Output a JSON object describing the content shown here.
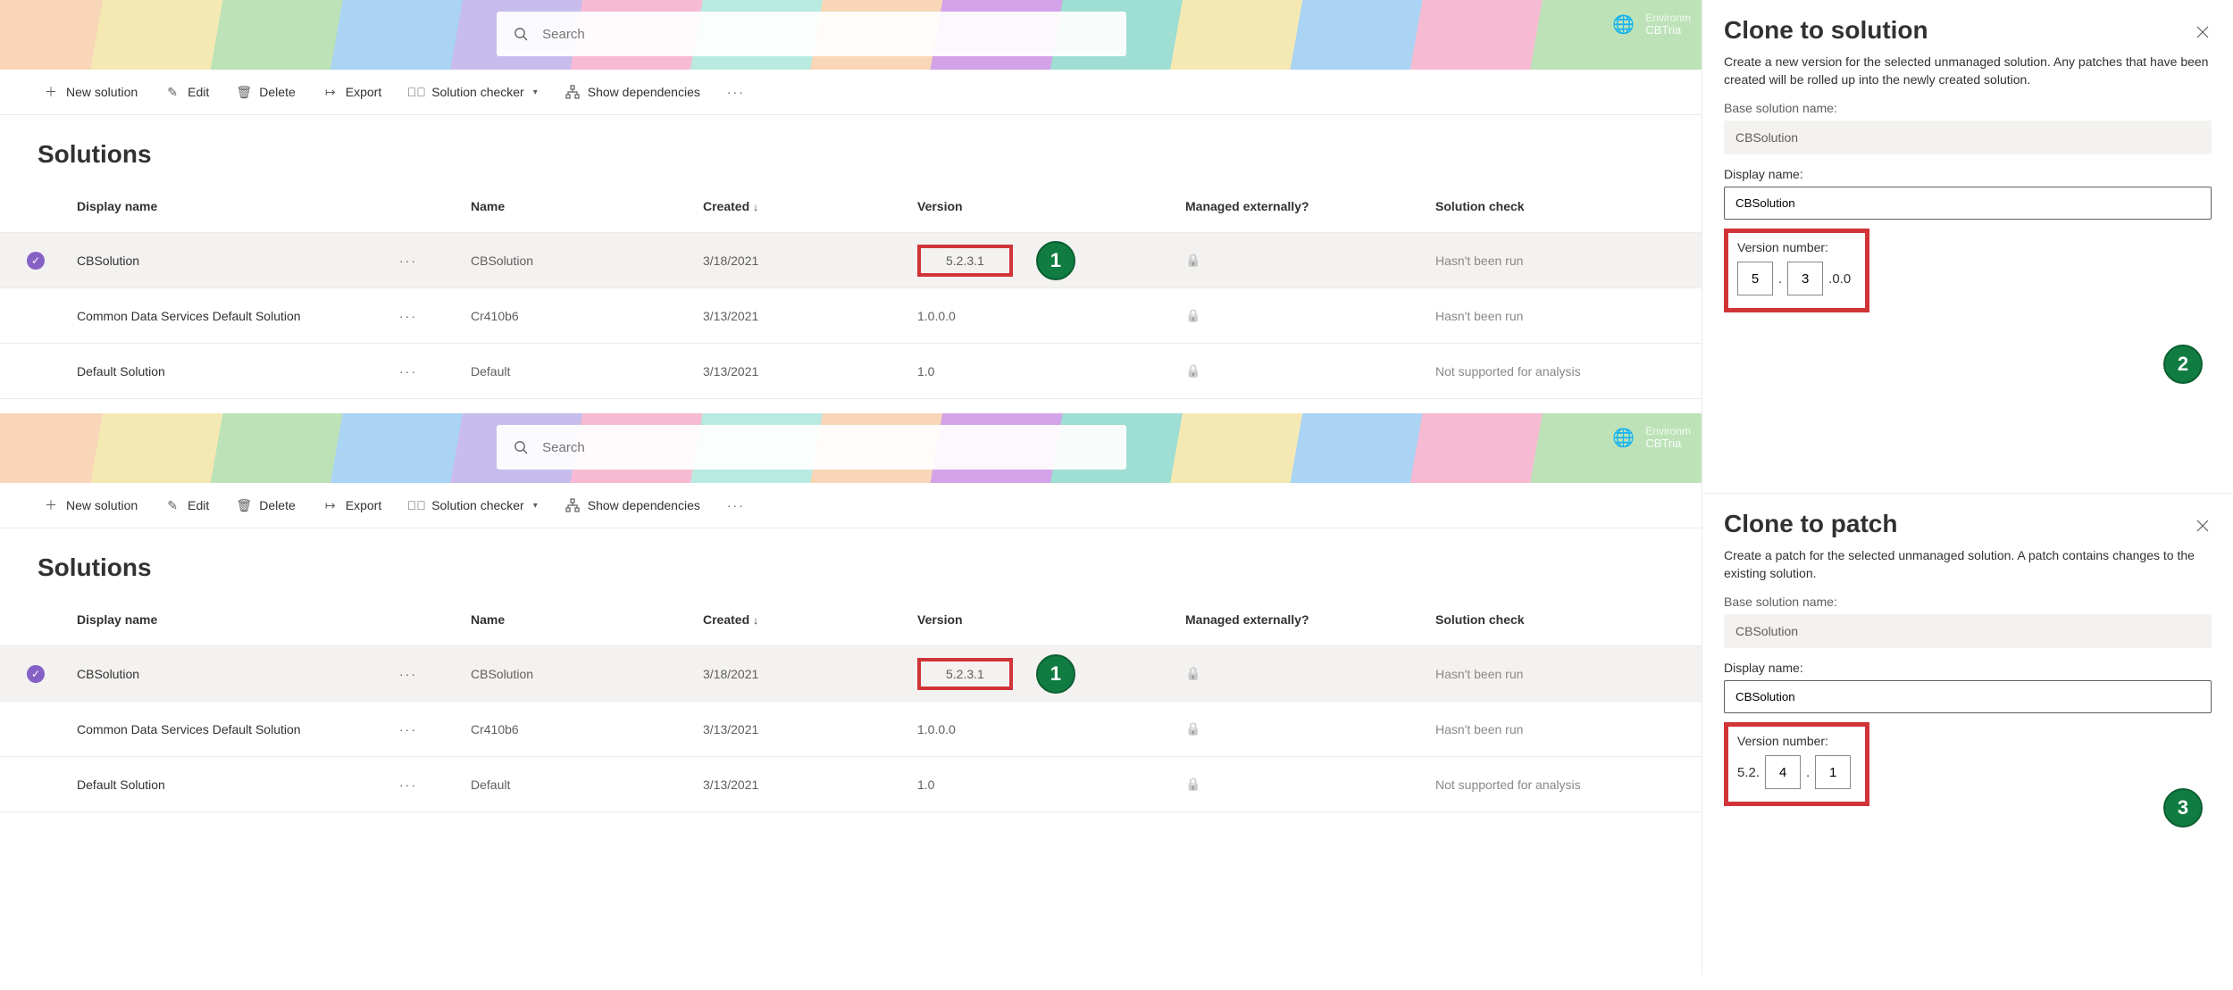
{
  "search": {
    "placeholder": "Search"
  },
  "env": {
    "label": "Environm",
    "name": "CBTria"
  },
  "toolbar": {
    "new_solution": "New solution",
    "edit": "Edit",
    "delete": "Delete",
    "export": "Export",
    "solution_checker": "Solution checker",
    "show_dependencies": "Show dependencies"
  },
  "heading": "Solutions",
  "columns": {
    "display_name": "Display name",
    "name": "Name",
    "created": "Created",
    "version": "Version",
    "managed": "Managed externally?",
    "check": "Solution check"
  },
  "rows": [
    {
      "display_name": "CBSolution",
      "name": "CBSolution",
      "created": "3/18/2021",
      "version": "5.2.3.1",
      "managed_icon": "lock",
      "check": "Hasn't been run",
      "selected": true,
      "callout": "1"
    },
    {
      "display_name": "Common Data Services Default Solution",
      "name": "Cr410b6",
      "created": "3/13/2021",
      "version": "1.0.0.0",
      "managed_icon": "lock",
      "check": "Hasn't been run"
    },
    {
      "display_name": "Default Solution",
      "name": "Default",
      "created": "3/13/2021",
      "version": "1.0",
      "managed_icon": "lock",
      "check": "Not supported for analysis"
    }
  ],
  "panel_solution": {
    "title": "Clone to solution",
    "desc": "Create a new version for the selected unmanaged solution. Any patches that have been created will be rolled up into the newly created solution.",
    "base_label": "Base solution name:",
    "base_value": "CBSolution",
    "display_label": "Display name:",
    "display_value": "CBSolution",
    "version_label": "Version number:",
    "v_major": "5",
    "v_minor": "3",
    "v_suffix": ".0.0",
    "callout": "2"
  },
  "panel_patch": {
    "title": "Clone to patch",
    "desc": "Create a patch for the selected unmanaged solution. A patch contains changes to the existing solution.",
    "base_label": "Base solution name:",
    "base_value": "CBSolution",
    "display_label": "Display name:",
    "display_value": "CBSolution",
    "version_label": "Version number:",
    "v_prefix": "5.2.",
    "v_build": "4",
    "v_rev": "1",
    "callout": "3"
  }
}
